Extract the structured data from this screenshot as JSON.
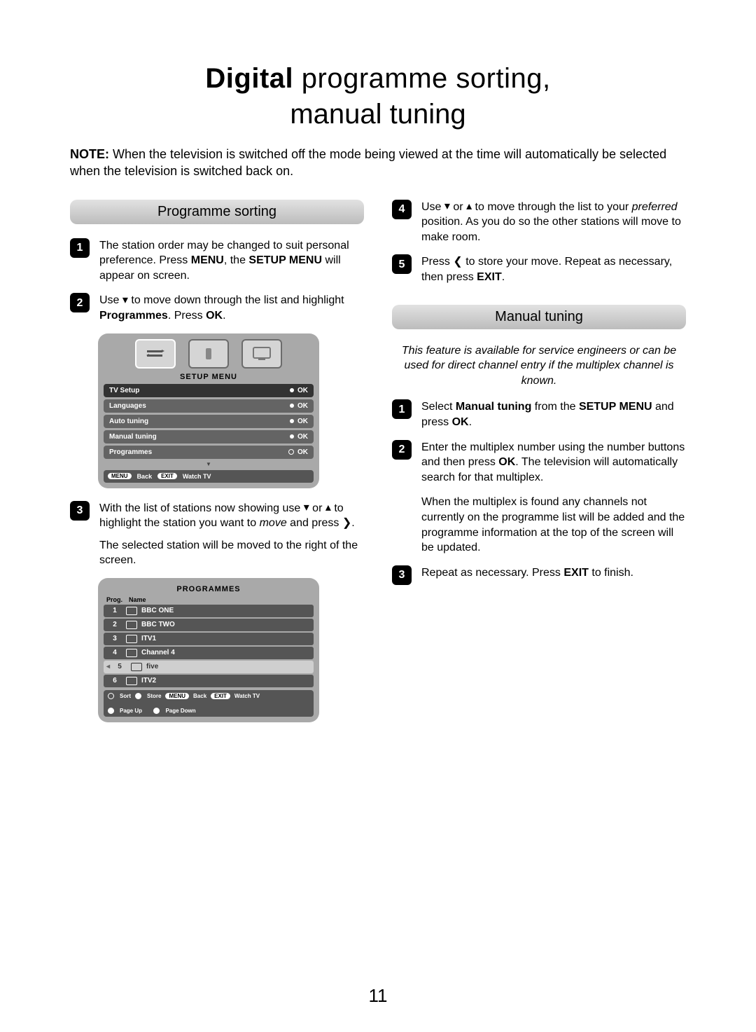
{
  "title": {
    "bold": "Digital",
    "rest": " programme sorting,",
    "line2": "manual tuning"
  },
  "note": {
    "label": "NOTE:",
    "text": " When the television is switched off the mode being viewed at the time will automatically be selected when the television is switched back on."
  },
  "page_number": "11",
  "left": {
    "heading": "Programme sorting",
    "steps": {
      "s1": {
        "n": "1",
        "html": "The station order may be changed to suit personal preference. Press <b>MENU</b>, the <b>SETUP MENU</b> will appear on screen."
      },
      "s2": {
        "n": "2",
        "html": "Use <span class='arrow'>▾</span> to move down through the list and highlight <b>Programmes</b>. Press <b>OK</b>."
      },
      "s3": {
        "n": "3",
        "html": "With the list of stations now showing use <span class='arrow'>▾</span> or <span class='arrow'>▴</span> to highlight the station you want to <i>move</i> and press <span class='arrow'>❯</span>."
      },
      "s3b": "The selected station will be moved to the right of the screen."
    },
    "setup_menu": {
      "title": "SETUP MENU",
      "items": [
        {
          "label": "TV Setup",
          "action": "OK",
          "type": "dot"
        },
        {
          "label": "Languages",
          "action": "OK",
          "type": "dot"
        },
        {
          "label": "Auto tuning",
          "action": "OK",
          "type": "dot"
        },
        {
          "label": "Manual tuning",
          "action": "OK",
          "type": "dot"
        },
        {
          "label": "Programmes",
          "action": "OK",
          "type": "circle"
        }
      ],
      "footer": {
        "menu": "MENU",
        "back": "Back",
        "exit": "EXIT",
        "watch": "Watch TV"
      }
    },
    "programmes": {
      "title": "PROGRAMMES",
      "col1": "Prog.",
      "col2": "Name",
      "rows": [
        {
          "n": "1",
          "name": "BBC ONE"
        },
        {
          "n": "2",
          "name": "BBC TWO"
        },
        {
          "n": "3",
          "name": "ITV1"
        },
        {
          "n": "4",
          "name": "Channel 4"
        },
        {
          "n": "5",
          "name": "five",
          "sel": true
        },
        {
          "n": "6",
          "name": "ITV2"
        }
      ],
      "footer": {
        "sort": "Sort",
        "store": "Store",
        "menu": "MENU",
        "back": "Back",
        "exit": "EXIT",
        "watch": "Watch TV",
        "pu": "Page Up",
        "pd": "Page Down"
      }
    }
  },
  "right": {
    "steps_a": {
      "s4": {
        "n": "4",
        "html": "Use <span class='arrow'>▾</span> or <span class='arrow'>▴</span> to move through the list to your <i>preferred</i> position. As you do so the other stations will move to make room."
      },
      "s5": {
        "n": "5",
        "html": "Press <span class='arrow'>❮</span> to store your move. Repeat as necessary, then press <b>EXIT</b>."
      }
    },
    "heading": "Manual tuning",
    "intro": "This feature is available for service engineers or can be used for direct channel entry if the multiplex channel is known.",
    "steps_b": {
      "s1": {
        "n": "1",
        "html": "Select <b>Manual tuning</b> from the <b>SETUP MENU</b> and press <b>OK</b>."
      },
      "s2": {
        "n": "2",
        "html": "Enter the multiplex number using the number buttons and then press <b>OK</b>. The television will automatically search for that multiplex."
      },
      "s2b": "When the multiplex is found any channels not currently on the programme list will be added and the programme information at the top of the screen will be updated.",
      "s3": {
        "n": "3",
        "html": "Repeat as necessary. Press <b>EXIT</b> to finish."
      }
    }
  }
}
